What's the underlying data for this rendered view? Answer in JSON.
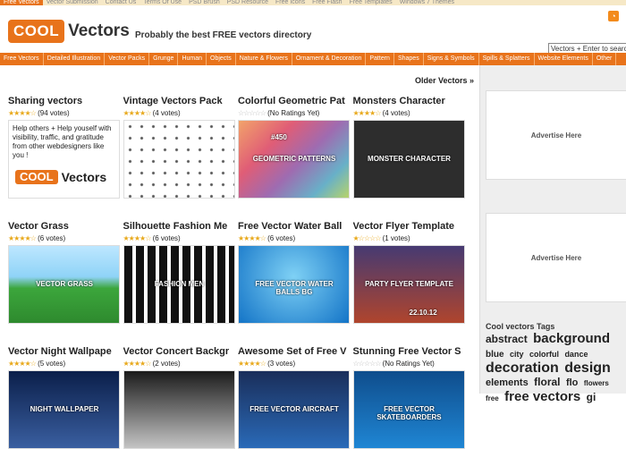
{
  "topbar": {
    "items": [
      "Free Vectors",
      "Vector Submission",
      "Contact Us",
      "Terms Of Use",
      "PSD Brush",
      "PSD Resource",
      "Free Icons",
      "Free Flash",
      "Free Templates",
      "Windows 7 Themes"
    ]
  },
  "header": {
    "logo_cool": "COOL",
    "logo_vectors": "Vectors",
    "tagline": "Probably the best FREE vectors directory",
    "rss_glyph": "◔",
    "search_value": "Vectors + Enter to search"
  },
  "nav": {
    "items": [
      "Free Vectors",
      "Detailed Illustration",
      "Vector Packs",
      "Grunge",
      "Human",
      "Objects",
      "Nature & Flowers",
      "Ornament & Decoration",
      "Pattern",
      "Shapes",
      "Signs & Symbols",
      "Spills & Splatters",
      "Website Elements",
      "Other"
    ]
  },
  "main": {
    "older_link": "Older Vectors »",
    "cards": [
      {
        "title": "Sharing vectors",
        "rating": "(94 votes)",
        "stars": 4,
        "share_text": "Help others + Help youself with visibility, traffic, and gratitude from other webdesigners like you !"
      },
      {
        "title": "Vintage Vectors Pack",
        "rating": "(4 votes)",
        "stars": 4
      },
      {
        "title": "Colorful Geometric Pat",
        "rating": "(No Ratings Yet)",
        "stars": 0,
        "thumb_text": "GEOMETRIC PATTERNS",
        "thumb_num": "#450"
      },
      {
        "title": "Monsters Character",
        "rating": "(4 votes)",
        "stars": 4,
        "thumb_text": "MONSTER CHARACTER"
      },
      {
        "title": "Vector Grass",
        "rating": "(6 votes)",
        "stars": 4,
        "thumb_text": "VECTOR GRASS"
      },
      {
        "title": "Silhouette Fashion Me",
        "rating": "(6 votes)",
        "stars": 4,
        "thumb_text": "FASHION MEN"
      },
      {
        "title": "Free Vector Water Ball",
        "rating": "(6 votes)",
        "stars": 4,
        "thumb_text": "FREE VECTOR WATER BALLS BG"
      },
      {
        "title": "Vector Flyer Template",
        "rating": "(1 votes)",
        "stars": 1,
        "thumb_text": "PARTY FLYER TEMPLATE",
        "thumb_date": "22.10.12"
      },
      {
        "title": "Vector Night Wallpape",
        "rating": "(5 votes)",
        "stars": 4,
        "thumb_text": "NIGHT WALLPAPER"
      },
      {
        "title": "Vector Concert Backgr",
        "rating": "(2 votes)",
        "stars": 4
      },
      {
        "title": "Awesome Set of Free V",
        "rating": "(3 votes)",
        "stars": 4,
        "thumb_text": "FREE VECTOR AIRCRAFT"
      },
      {
        "title": "Stunning Free Vector S",
        "rating": "(No Ratings Yet)",
        "stars": 0,
        "thumb_text": "FREE VECTOR SKATEBOARDERS"
      }
    ]
  },
  "sidebar": {
    "ad1": "Advertise Here",
    "ad2": "Advertise Here",
    "tags_title": "Cool vectors Tags",
    "tags": [
      {
        "t": "abstract",
        "s": 12
      },
      {
        "t": "background",
        "s": 15
      },
      {
        "t": "blue",
        "s": 10
      },
      {
        "t": "city",
        "s": 9
      },
      {
        "t": "colorful",
        "s": 9
      },
      {
        "t": "dance",
        "s": 9
      },
      {
        "t": "decoration",
        "s": 16
      },
      {
        "t": "design",
        "s": 16
      },
      {
        "t": "elements",
        "s": 11
      },
      {
        "t": "floral",
        "s": 12
      },
      {
        "t": "flo",
        "s": 11
      },
      {
        "t": "flowers",
        "s": 8
      },
      {
        "t": "free",
        "s": 8
      },
      {
        "t": "free vectors",
        "s": 15
      },
      {
        "t": "gi",
        "s": 12
      }
    ]
  }
}
